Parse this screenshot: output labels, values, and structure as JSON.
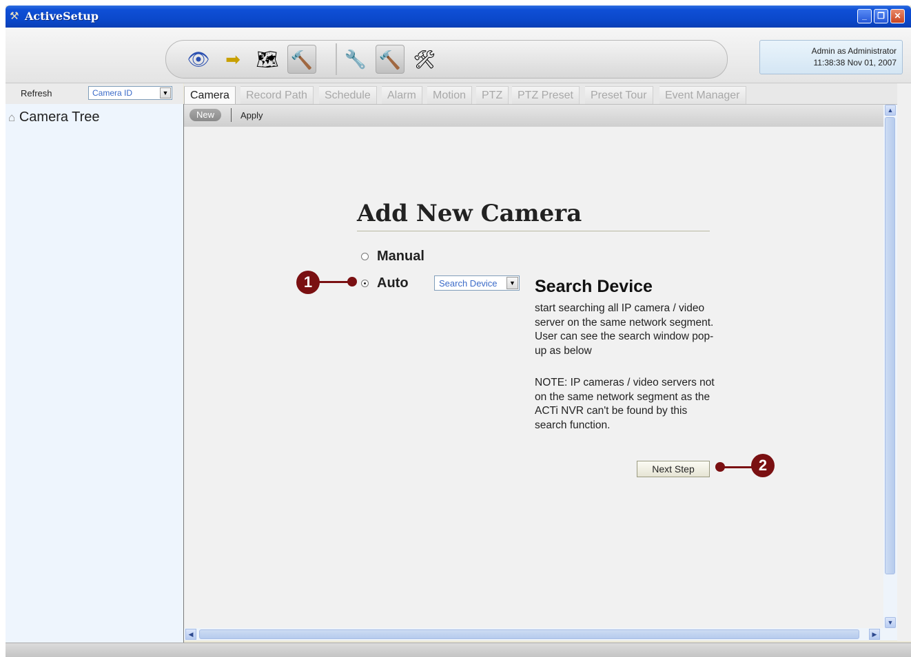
{
  "window": {
    "title": "ActiveSetup",
    "controls": [
      "minimize",
      "restore",
      "close"
    ]
  },
  "toolbar": {
    "tools": [
      {
        "icon": "eye-icon",
        "glyph": "👁"
      },
      {
        "icon": "arrow-tape-icon",
        "glyph": "➡"
      },
      {
        "icon": "map-icon",
        "glyph": "🗺"
      },
      {
        "icon": "tools-icon",
        "glyph": "🔨"
      },
      {
        "icon": "tools-wrench-icon",
        "glyph": "🔧"
      },
      {
        "icon": "tools-camera-icon",
        "glyph": "🔨"
      },
      {
        "icon": "tools-settings-icon",
        "glyph": "🛠"
      }
    ],
    "user_line": "Admin as Administrator",
    "datetime": "11:38:38 Nov 01, 2007"
  },
  "left": {
    "refresh_label": "Refresh",
    "sort_value": "Camera ID",
    "tree_root": "Camera Tree"
  },
  "tabs": [
    "Camera",
    "Record Path",
    "Schedule",
    "Alarm",
    "Motion",
    "PTZ",
    "PTZ Preset",
    "Preset Tour",
    "Event Manager"
  ],
  "active_tab": "Camera",
  "subbar": {
    "new_label": "New",
    "apply_label": "Apply"
  },
  "form": {
    "heading": "Add New Camera",
    "option_manual": "Manual",
    "option_auto": "Auto",
    "selected_option": "Auto",
    "search_select_value": "Search Device",
    "panel_title": "Search Device",
    "panel_desc": "start searching all IP camera / video server on the same network segment. User can see the search window pop-up as below",
    "panel_note": "NOTE: IP cameras / video servers not on the same network segment as the ACTi NVR can't be found by this search function.",
    "next_label": "Next Step"
  },
  "callouts": [
    "1",
    "2"
  ],
  "colors": {
    "titlebar": "#0a47c9",
    "callout": "#7a1012",
    "link_blue": "#3a6ac8"
  }
}
